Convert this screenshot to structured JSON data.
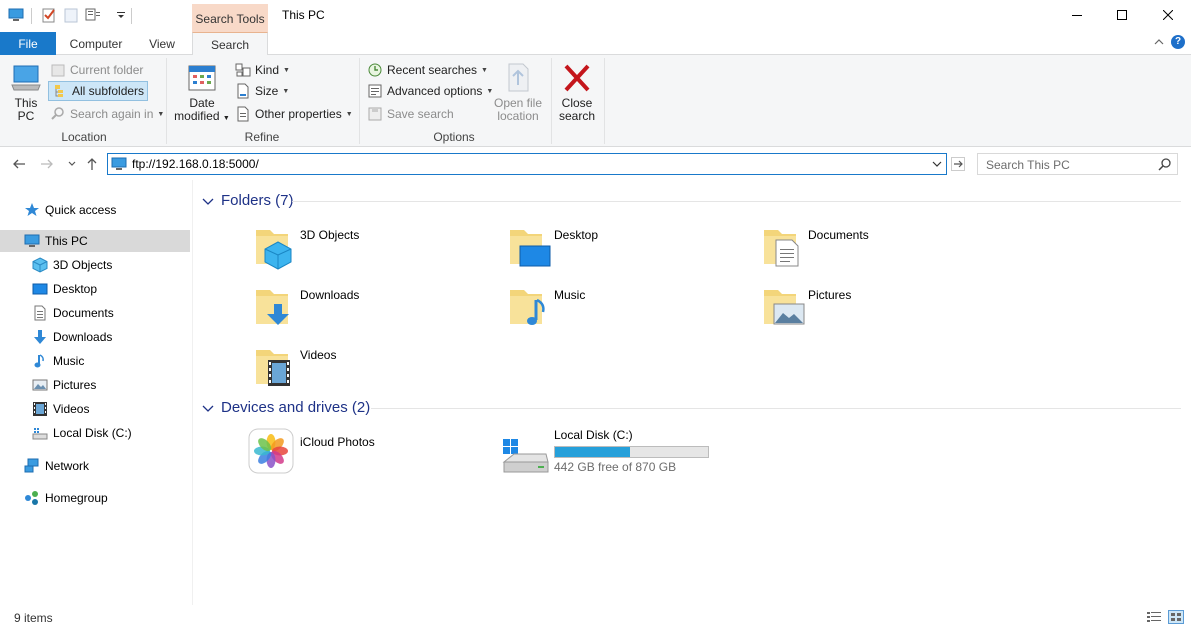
{
  "window": {
    "title": "This PC",
    "context_tab_header": "Search Tools"
  },
  "tabs": {
    "file": "File",
    "computer": "Computer",
    "view": "View",
    "search": "Search"
  },
  "ribbon": {
    "location": {
      "label": "Location",
      "this_pc_line1": "This",
      "this_pc_line2": "PC",
      "current_folder": "Current folder",
      "all_subfolders": "All subfolders",
      "search_again_in": "Search again in"
    },
    "refine": {
      "label": "Refine",
      "date_modified_line1": "Date",
      "date_modified_line2": "modified",
      "kind": "Kind",
      "size": "Size",
      "other_properties": "Other properties"
    },
    "options": {
      "label": "Options",
      "recent_searches": "Recent searches",
      "advanced_options": "Advanced options",
      "save_search": "Save search",
      "open_file_location_line1": "Open file",
      "open_file_location_line2": "location",
      "close_search_line1": "Close",
      "close_search_line2": "search"
    }
  },
  "address": {
    "path": "ftp://192.168.0.18:5000/",
    "search_placeholder": "Search This PC"
  },
  "nav": {
    "quick_access": "Quick access",
    "this_pc": "This PC",
    "objects_3d": "3D Objects",
    "desktop": "Desktop",
    "documents": "Documents",
    "downloads": "Downloads",
    "music": "Music",
    "pictures": "Pictures",
    "videos": "Videos",
    "local_disk": "Local Disk (C:)",
    "network": "Network",
    "homegroup": "Homegroup"
  },
  "content": {
    "folders_header": "Folders (7)",
    "folders": [
      "3D Objects",
      "Desktop",
      "Documents",
      "Downloads",
      "Music",
      "Pictures",
      "Videos"
    ],
    "devices_header": "Devices and drives (2)",
    "icloud_photos": "iCloud Photos",
    "local_disk": {
      "name": "Local Disk (C:)",
      "free_text": "442 GB free of 870 GB",
      "used_fraction": 0.49
    }
  },
  "status": {
    "item_count": "9 items"
  },
  "colors": {
    "accent": "#1979ca",
    "drive_fill": "#26a0da",
    "context_tab": "#f8d9c8",
    "header_text": "#1e3287"
  }
}
